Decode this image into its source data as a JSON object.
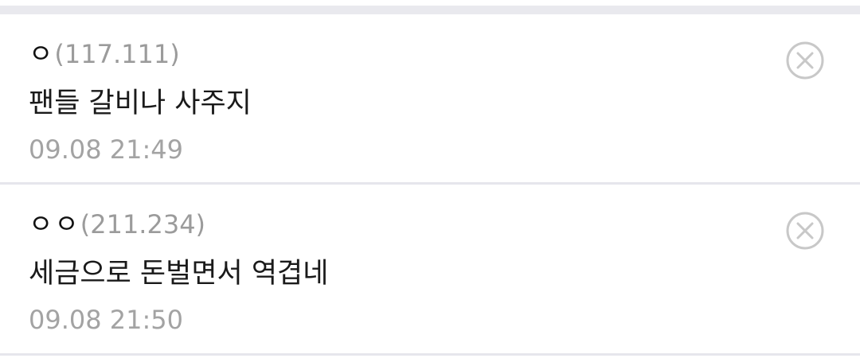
{
  "comments": [
    {
      "nickname": "ㅇ",
      "ip": "(117.111)",
      "text": "팬들 갈비나 사주지",
      "time": "09.08 21:49"
    },
    {
      "nickname": "ㅇㅇ",
      "ip": "(211.234)",
      "text": "세금으로 돈벌면서 역겹네",
      "time": "09.08 21:50"
    }
  ],
  "colors": {
    "separator": "#e6e6ec",
    "meta_text": "#9b9b9b",
    "delete_icon": "#c8c8c8"
  },
  "icons": {
    "delete": "circle-x-icon"
  }
}
